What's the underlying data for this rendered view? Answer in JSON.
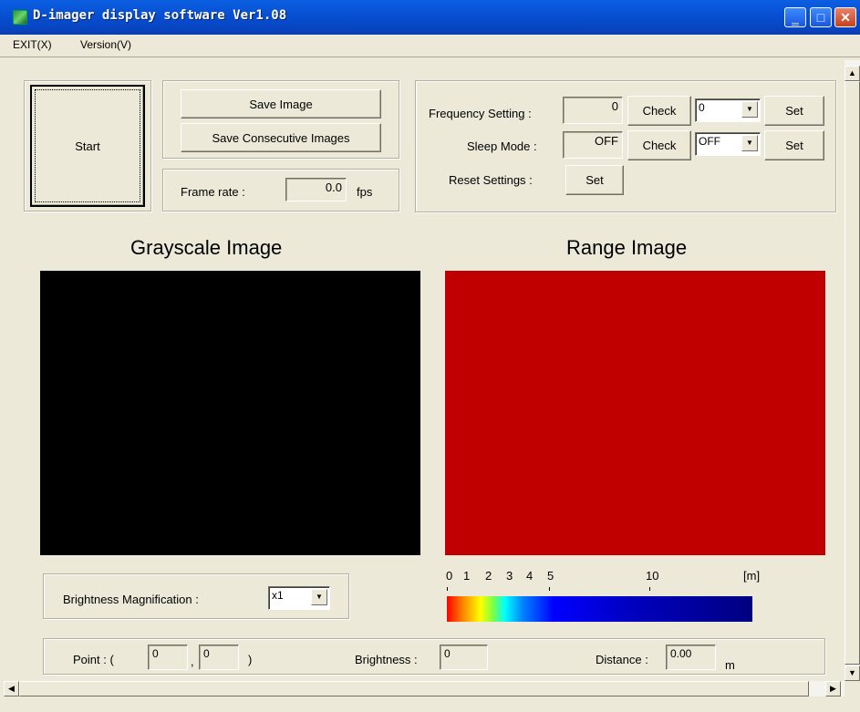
{
  "window": {
    "title": "D-imager display software Ver1.08"
  },
  "menu": {
    "exit": "EXIT(X)",
    "version": "Version(V)"
  },
  "controls": {
    "start": "Start",
    "save_image": "Save Image",
    "save_consecutive": "Save Consecutive Images",
    "frame_rate_label": "Frame rate :",
    "frame_rate_value": "0.0",
    "frame_rate_unit": "fps"
  },
  "settings": {
    "frequency_label": "Frequency Setting :",
    "frequency_value": "0",
    "frequency_check": "Check",
    "frequency_select": "0",
    "frequency_set": "Set",
    "sleep_label": "Sleep Mode :",
    "sleep_value": "OFF",
    "sleep_check": "Check",
    "sleep_select": "OFF",
    "sleep_set": "Set",
    "reset_label": "Reset Settings :",
    "reset_set": "Set"
  },
  "images": {
    "grayscale_title": "Grayscale Image",
    "range_title": "Range Image",
    "grayscale_color": "#000000",
    "range_color": "#c00000"
  },
  "brightness": {
    "label": "Brightness Magnification :",
    "value": "x1"
  },
  "scale": {
    "ticks": [
      "0",
      "1",
      "2",
      "3",
      "4",
      "5",
      "10"
    ],
    "unit": "[m]"
  },
  "status": {
    "point_label": "Point : (",
    "point_x": "0",
    "comma": ",",
    "point_y": "0",
    "close_paren": ")",
    "brightness_label": "Brightness :",
    "brightness_value": "0",
    "distance_label": "Distance :",
    "distance_value": "0.00",
    "distance_unit": "m"
  }
}
